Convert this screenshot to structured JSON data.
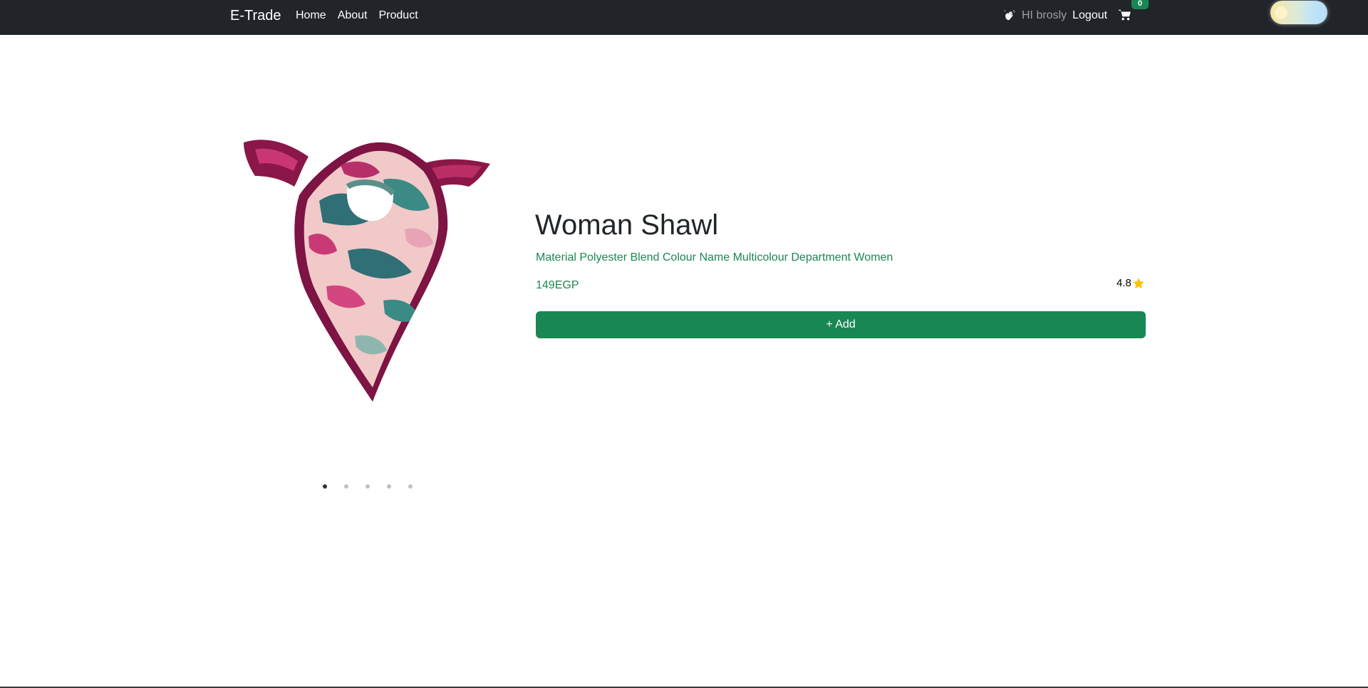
{
  "navbar": {
    "brand": "E-Trade",
    "links": [
      "Home",
      "About",
      "Product"
    ],
    "greeting": "HI brosly",
    "logout_label": "Logout",
    "cart_count": "0",
    "icons": {
      "wave": "waving-hand-icon",
      "cart": "cart-icon"
    }
  },
  "product": {
    "title": "Woman Shawl",
    "description": "Material Polyester Blend Colour Name Multicolour Department Women",
    "price": "149EGP",
    "rating": "4.8",
    "add_label": "+ Add",
    "image_alt": "scarf-image"
  },
  "carousel": {
    "slide_count": 5,
    "active_index": 0
  },
  "colors": {
    "navbar_bg": "#212529",
    "accent_green": "#198754",
    "star": "#ffc107"
  }
}
